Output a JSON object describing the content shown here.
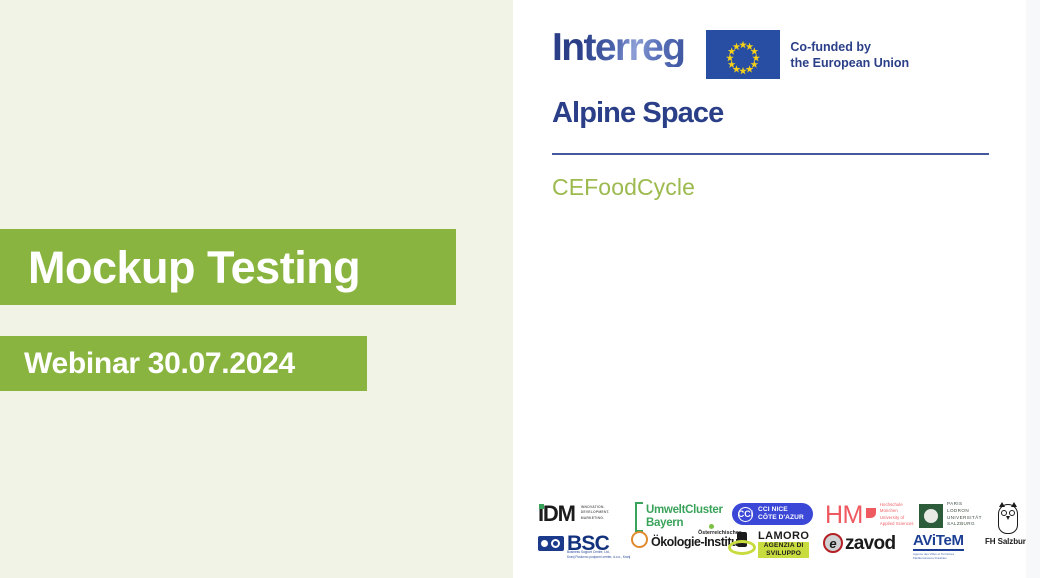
{
  "left": {
    "title": "Mockup Testing",
    "subtitle": "Webinar 30.07.2024",
    "background_color": "#f1f3e6",
    "banner_color": "#8ab440"
  },
  "brand": {
    "interreg_word": "Interreg",
    "programme": "Alpine Space",
    "project": "CEFoodCycle",
    "eu_funding_line1": "Co-funded by",
    "eu_funding_line2": "the European Union",
    "flag_icon": "eu-flag-icon",
    "navy_color": "#2a3f87",
    "project_color": "#9cba4e",
    "divider_color": "#45589e"
  },
  "partners": [
    {
      "id": "idm",
      "name": "IDM",
      "tagline": [
        "INNOVATION.",
        "DEVELOPMENT.",
        "MARKETING."
      ]
    },
    {
      "id": "bsc",
      "name": "BSC",
      "tagline": [
        "Business Support Centre, Ltd.,",
        "Kranj Poslovno podporni center, d.o.o., Kranj"
      ]
    },
    {
      "id": "umweltcluster-bayern",
      "name_line1": "UmweltCluster",
      "name_line2": "Bayern"
    },
    {
      "id": "oekologie-institut",
      "name_top": "Österreichisches",
      "name_main": "Ökologie-Institut"
    },
    {
      "id": "cci-nice-cote-dazur",
      "badge": "CCi",
      "name_line1": "CCI NICE",
      "name_line2": "CÔTE D'AZUR"
    },
    {
      "id": "lamoro",
      "name": "LAMORO",
      "sub_line1": "AGENZIA DI",
      "sub_line2": "SVILUPPO"
    },
    {
      "id": "hochschule-muenchen",
      "name": "HM",
      "tagline": [
        "Hochschule",
        "München",
        "University of",
        "Applied Sciences"
      ]
    },
    {
      "id": "e-zavod",
      "badge": "e",
      "name": "zavod"
    },
    {
      "id": "plus-salzburg",
      "tagline": [
        "PARIS",
        "LODRON",
        "UNIVERSITÄT",
        "SALZBURG"
      ]
    },
    {
      "id": "avitem",
      "name": "AViTeM",
      "tagline": [
        "Agence des Villes et Territoires",
        "Méditerranéens Durables"
      ]
    },
    {
      "id": "fh-salzburg",
      "name": "FH Salzburg",
      "icon": "owl-icon"
    }
  ]
}
